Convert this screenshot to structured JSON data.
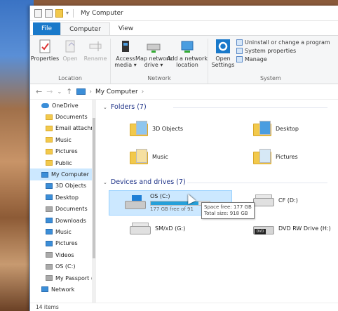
{
  "window": {
    "title": "My Computer"
  },
  "tabs": [
    "File",
    "Computer",
    "View"
  ],
  "ribbon": {
    "location": {
      "label": "Location",
      "buttons": [
        "Properties",
        "Open",
        "Rename"
      ]
    },
    "network": {
      "label": "Network",
      "buttons": [
        "Access\nmedia ▾",
        "Map network\ndrive ▾",
        "Add a network\nlocation"
      ]
    },
    "system": {
      "label": "System",
      "open_settings": "Open\nSettings",
      "items": [
        "Uninstall or change a program",
        "System properties",
        "Manage"
      ]
    }
  },
  "address": {
    "path": "My Computer",
    "separator": "›"
  },
  "sidebar": {
    "items": [
      {
        "label": "OneDrive",
        "icon": "cloud-icon",
        "top": true
      },
      {
        "label": "Documents",
        "icon": "folder-icon"
      },
      {
        "label": "Email attachm",
        "icon": "folder-icon"
      },
      {
        "label": "Music",
        "icon": "folder-icon"
      },
      {
        "label": "Pictures",
        "icon": "folder-icon"
      },
      {
        "label": "Public",
        "icon": "folder-icon"
      },
      {
        "label": "My Computer",
        "icon": "computer-icon",
        "top": true,
        "selected": true
      },
      {
        "label": "3D Objects",
        "icon": "blue-folder-icon"
      },
      {
        "label": "Desktop",
        "icon": "blue-folder-icon"
      },
      {
        "label": "Documents",
        "icon": "doc-icon"
      },
      {
        "label": "Downloads",
        "icon": "download-icon"
      },
      {
        "label": "Music",
        "icon": "music-icon"
      },
      {
        "label": "Pictures",
        "icon": "picture-icon"
      },
      {
        "label": "Videos",
        "icon": "video-icon"
      },
      {
        "label": "OS (C:)",
        "icon": "drive-icon"
      },
      {
        "label": "My Passport (",
        "icon": "drive-icon"
      },
      {
        "label": "Network",
        "icon": "network-icon",
        "top": true
      }
    ]
  },
  "folders": {
    "header": "Folders (7)",
    "items": [
      "3D Objects",
      "Desktop",
      "Music",
      "Pictures"
    ]
  },
  "drives": {
    "header": "Devices and drives (7)",
    "os": {
      "label": "OS (C:)",
      "free_text": "177 GB free of 91",
      "used_fraction": 0.81
    },
    "cf": {
      "label": "CF (D:)"
    },
    "sm": {
      "label": "SM/xD (G:)"
    },
    "dvd": {
      "label": "DVD RW Drive (H:)"
    }
  },
  "tooltip": {
    "line1": "Space free: 177 GB",
    "line2": "Total size: 918 GB"
  },
  "status": {
    "count": "14 items"
  },
  "colors": {
    "accent": "#1979ca",
    "selection": "#cce8ff",
    "bar": "#26a0da",
    "section": "#1e3287"
  }
}
